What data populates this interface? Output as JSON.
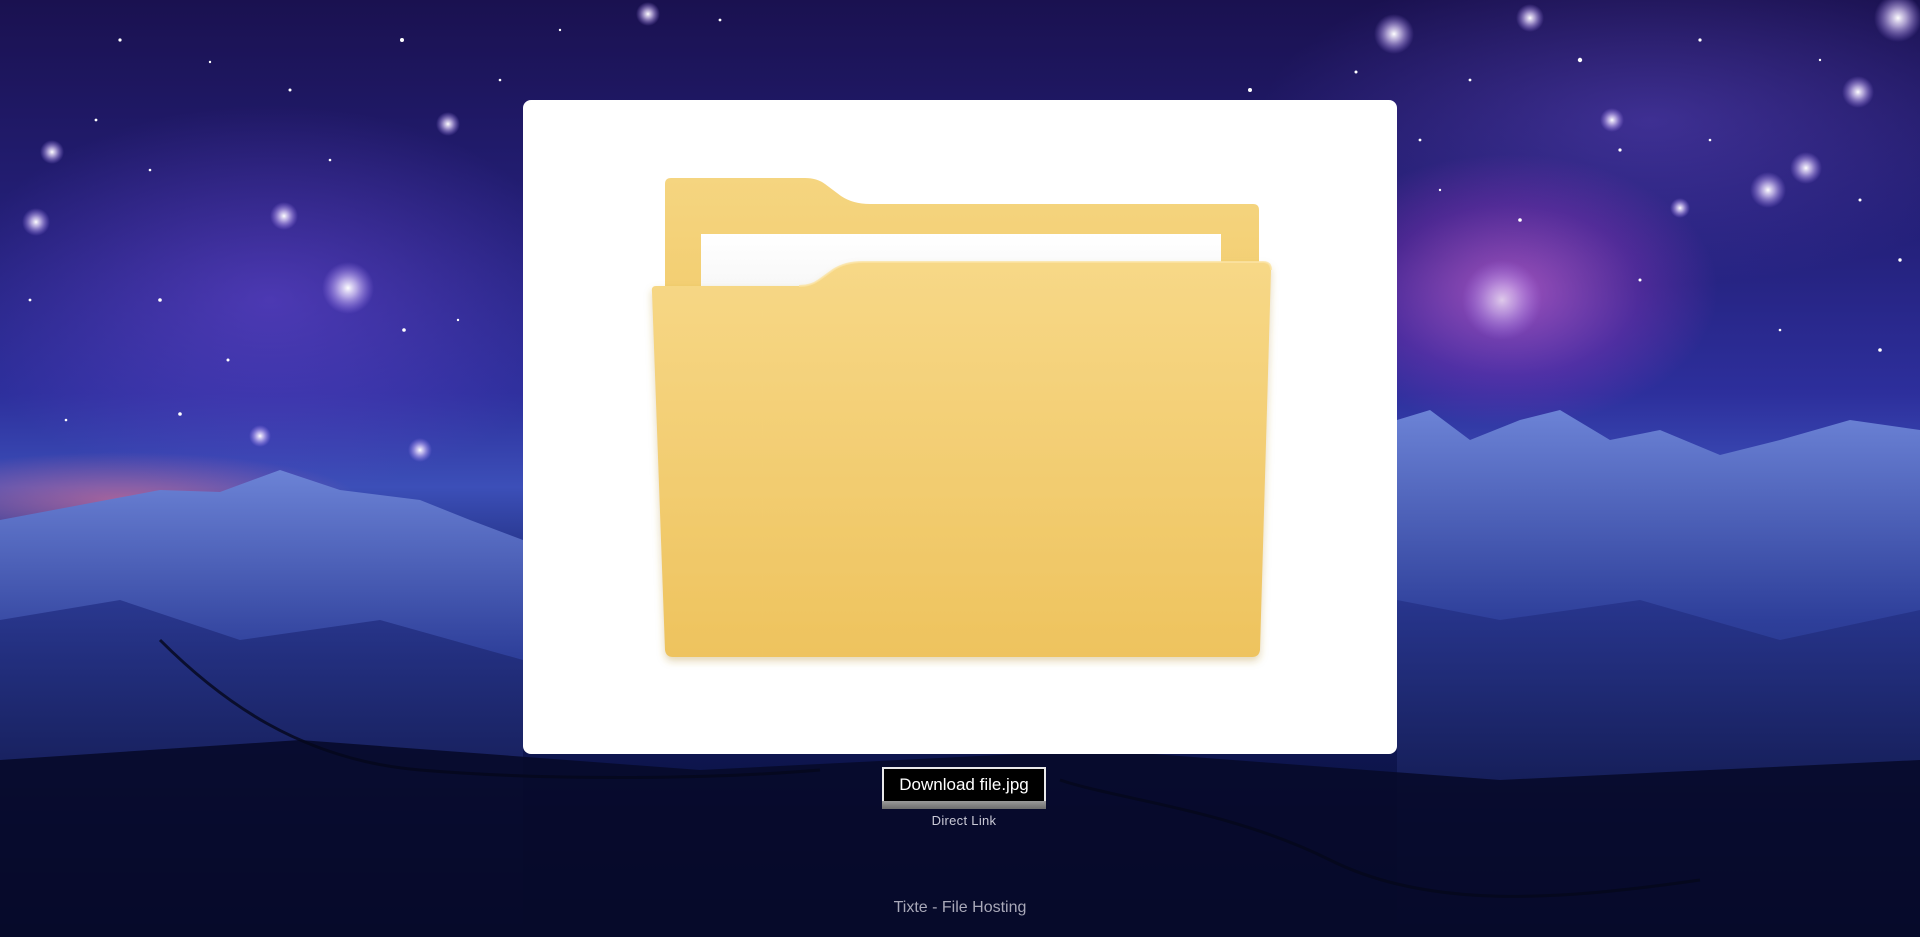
{
  "background": {
    "description_icon": "starry-sky-mountain-background"
  },
  "preview": {
    "icon": "folder-icon",
    "folder_color": "#F4CC6E",
    "paper_color": "#FFFFFF"
  },
  "download": {
    "label": "Download file.jpg"
  },
  "direct_link": {
    "label": "Direct Link"
  },
  "footer": {
    "text": "Tixte - File Hosting"
  }
}
